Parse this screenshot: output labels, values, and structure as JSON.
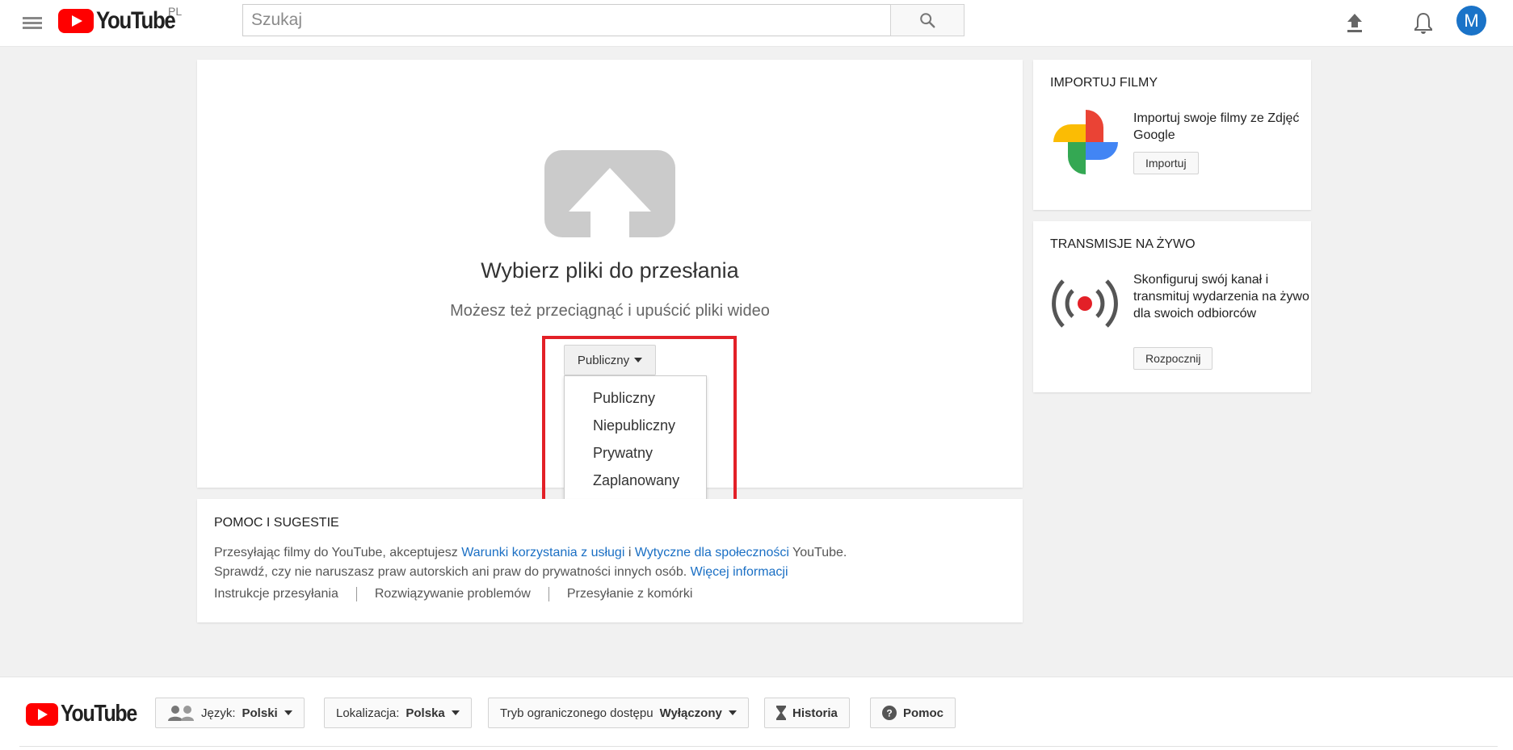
{
  "header": {
    "logo_text": "YouTube",
    "country_code": "PL",
    "search_placeholder": "Szukaj",
    "avatar_letter": "M"
  },
  "upload": {
    "title": "Wybierz pliki do przesłania",
    "subtitle": "Możesz też przeciągnąć i upuścić pliki wideo",
    "privacy_selected": "Publiczny",
    "privacy_options": [
      "Publiczny",
      "Niepubliczny",
      "Prywatny",
      "Zaplanowany"
    ]
  },
  "help": {
    "title": "POMOC I SUGESTIE",
    "line1_prefix": "Przesyłając filmy do YouTube, akceptujesz ",
    "line1_link1": "Warunki korzystania z usługi",
    "line1_mid": " i ",
    "line1_link2": "Wytyczne dla społeczności",
    "line1_suffix": " YouTube.",
    "line2_prefix": "Sprawdź, czy nie naruszasz praw autorskich ani praw do prywatności innych osób. ",
    "line2_link": "Więcej informacji",
    "links": [
      "Instrukcje przesyłania",
      "Rozwiązywanie problemów",
      "Przesyłanie z komórki"
    ]
  },
  "import_card": {
    "title": "IMPORTUJ FILMY",
    "text": "Importuj swoje filmy ze Zdjęć Google",
    "button": "Importuj"
  },
  "live_card": {
    "title": "TRANSMISJE NA ŻYWO",
    "text": "Skonfiguruj swój kanał i transmituj wydarzenia na żywo dla swoich odbiorców",
    "button": "Rozpocznij"
  },
  "footer": {
    "logo_text": "YouTube",
    "language_label": "Język:",
    "language_value": "Polski",
    "location_label": "Lokalizacja:",
    "location_value": "Polska",
    "restricted_label": "Tryb ograniczonego dostępu",
    "restricted_value": "Wyłączony",
    "history": "Historia",
    "help": "Pomoc"
  },
  "colors": {
    "brand_red": "#ff0000",
    "link_blue": "#1a6fc4",
    "highlight_red": "#e32027",
    "avatar_blue": "#1a73c8"
  },
  "icons": [
    "menu-icon",
    "search-icon",
    "upload-icon",
    "bell-icon",
    "upload-arrow-icon",
    "google-photos-icon",
    "live-broadcast-icon",
    "people-icon",
    "hourglass-icon",
    "help-circle-icon"
  ]
}
